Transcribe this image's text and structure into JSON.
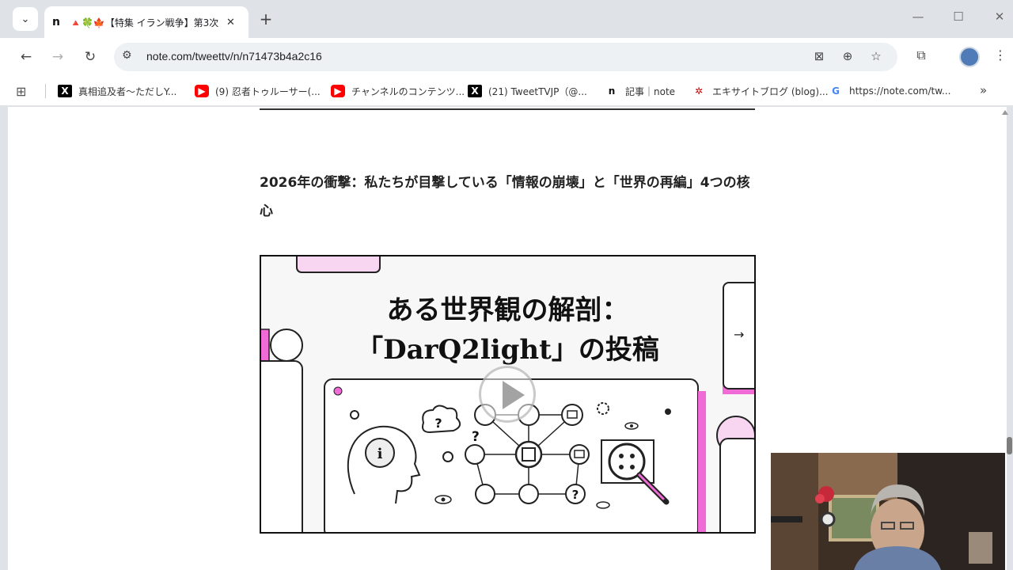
{
  "browser": {
    "tab": {
      "favicon_text": "n",
      "title": "🔺🍀🍁【特集 イラン戦争】第3次",
      "close_symbol": "✕"
    },
    "new_tab_symbol": "+",
    "url": "note.com/tweettv/n/n71473b4a2c16"
  },
  "bookmarks": [
    {
      "icon": "x-logo",
      "icon_text": "X",
      "label": "真相追及者〜ただしY..."
    },
    {
      "icon": "youtube-logo",
      "icon_text": "▶",
      "label": "(9) 忍者トゥルーサー(..."
    },
    {
      "icon": "youtube-logo",
      "icon_text": "▶",
      "label": "チャンネルのコンテンツ..."
    },
    {
      "icon": "x-logo",
      "icon_text": "X",
      "label": "(21) TweetTVJP（@..."
    },
    {
      "icon": "note-logo",
      "icon_text": "n",
      "label": "記事｜note"
    },
    {
      "icon": "excite-logo",
      "icon_text": "✲",
      "label": "エキサイトブログ (blog)..."
    },
    {
      "icon": "google-logo",
      "icon_text": "G",
      "label": "https://note.com/tw..."
    }
  ],
  "article": {
    "heading": "2026年の衝撃：私たちが目撃している「情報の崩壊」と「世界の再編」4つの核心",
    "embed": {
      "title_line1": "ある世界観の解剖：",
      "title_line2": "「DarQ2light」の投稿",
      "next_symbol": "→",
      "question_mark": "?"
    }
  },
  "colors": {
    "accent_pink": "#f06bd5",
    "light_pink": "#f8d6f1",
    "chrome_bg": "#dfe3e8"
  }
}
